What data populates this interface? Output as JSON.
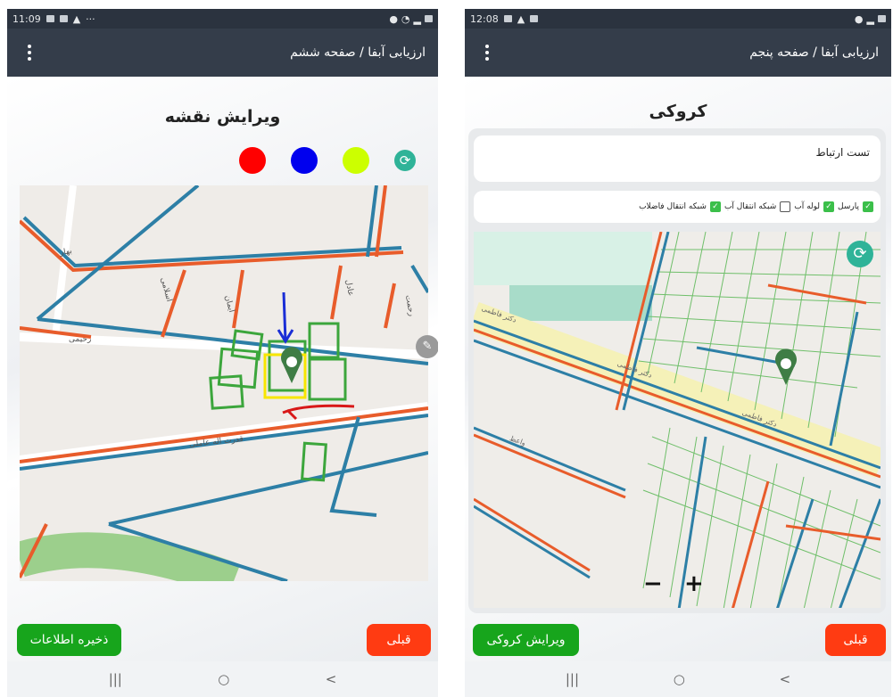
{
  "left_screen": {
    "status": {
      "time": "11:09",
      "dots": "···"
    },
    "appbar": {
      "title": "ارزیابی آبفا / صفحه ششم"
    },
    "heading": "ویرایش نقشه",
    "colors": {
      "red": "#ff0000",
      "blue": "#0000ee",
      "yellow": "#ccff00",
      "teal": "#2fb398"
    },
    "buttons": {
      "save": "ذخیره اطلاعات",
      "prev": "قبلی"
    },
    "nav": {
      "recents": "|||",
      "home": "○",
      "back": "<"
    },
    "map": {
      "street_labels": [
        "اسلامی",
        "ایمان",
        "رحیمی",
        "قدرت اله عاملی",
        "بهار",
        "عادل",
        "رحمت"
      ]
    }
  },
  "right_screen": {
    "status": {
      "time": "12:08"
    },
    "appbar": {
      "title": "ارزیابی آبفا / صفحه پنجم"
    },
    "heading": "کروکی",
    "note": "تست ارتباط",
    "layers": [
      {
        "label": "پارسل",
        "checked": true
      },
      {
        "label": "لوله آب",
        "checked": true
      },
      {
        "label": "شبکه انتقال آب",
        "checked": false
      },
      {
        "label": "شبکه انتقال فاضلاب",
        "checked": true
      }
    ],
    "zoom": {
      "minus": "−",
      "plus": "+"
    },
    "buttons": {
      "edit": "ویرایش کروکی",
      "prev": "قبلی"
    },
    "nav": {
      "recents": "|||",
      "home": "○",
      "back": "<"
    },
    "map": {
      "street_labels": [
        "دکتر فاطمی",
        "دکتر فاطمی",
        "دکتر فاطمی",
        "واعظ"
      ]
    }
  }
}
